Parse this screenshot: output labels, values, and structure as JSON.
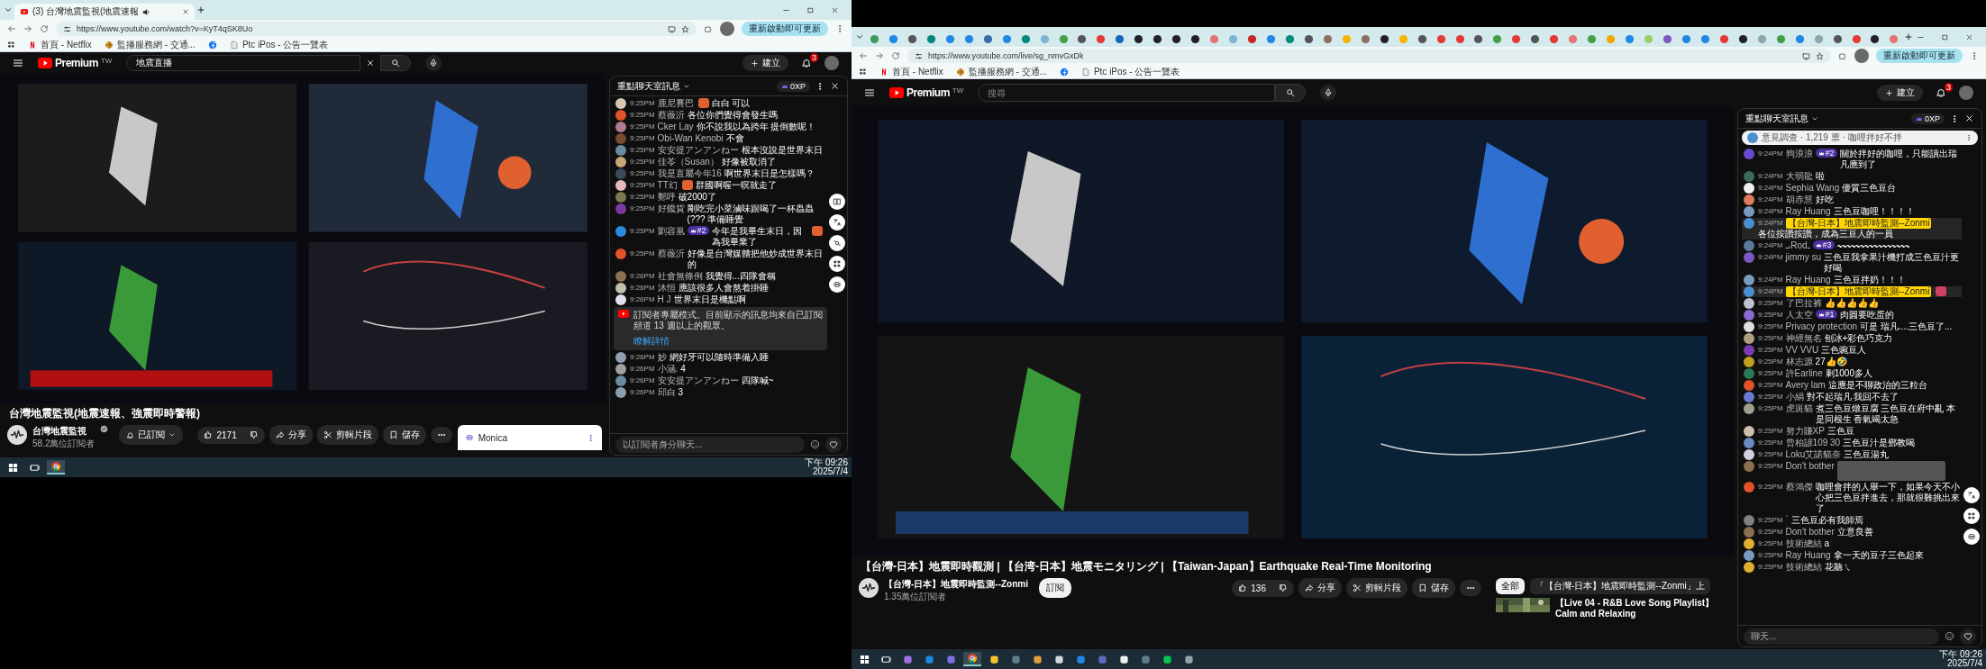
{
  "windows": [
    {
      "tabs": [
        {
          "title": "(3) 台灣地震監視(地震速報",
          "selected": true,
          "audio": true,
          "color": "#e02020"
        }
      ],
      "address": {
        "url": "https://www.youtube.com/watch?v=KyT4qSK8Uo"
      },
      "update_button": "重新啟動即可更新",
      "bookmarks": [
        {
          "label": "首頁 - Netflix",
          "kind": "netflix"
        },
        {
          "label": "監播服務網 - 交通...",
          "kind": "globe"
        },
        {
          "kind": "facebook"
        },
        {
          "label": "Ptc iPos - 公告一覽表",
          "kind": "doc"
        }
      ],
      "youtube": {
        "logo": "Premium",
        "logo_sup": "TW",
        "search": {
          "value": "地震直播"
        },
        "create": "建立",
        "notifications": "3"
      },
      "video": {
        "kind": "picture"
      },
      "title": "台灣地震監視(地震速報、強震即時警報)",
      "channel": {
        "name": "台灣地震監視",
        "subscribers": "58.2萬位訂閱者",
        "verified": true,
        "subscribe": {
          "label": "已訂閱",
          "subscribed": true
        }
      },
      "actions": {
        "likes": "2171",
        "share": "分享",
        "clip": "剪輯片段",
        "save": "儲存"
      },
      "monica": {
        "title": "Monica"
      },
      "chat": {
        "title": "重點聊天室訊息",
        "xp": "0XP",
        "input_placeholder": "以訂閱者身分聊天...",
        "side_tools": [
          {
            "kind": "book"
          },
          {
            "kind": "translate"
          },
          {
            "kind": "target"
          },
          {
            "kind": "grid"
          },
          {
            "kind": "robot"
          }
        ],
        "messages": [
          {
            "time": "9:25PM",
            "author": "鹿尼賽巴",
            "text": "白白 可以",
            "sticker_before": true,
            "color": "#d8c8b0"
          },
          {
            "time": "9:25PM",
            "author": "蔡薇沂",
            "text": "各位你們覺得會發生嗎",
            "color": "#e0522a"
          },
          {
            "time": "9:25PM",
            "author": "Cker Lay",
            "text": "你不說我以為跨年 提倒數呢！",
            "color": "#b07a90"
          },
          {
            "time": "9:25PM",
            "author": "Obi-Wan Kenobi",
            "text": "不會",
            "color": "#7a4a30"
          },
          {
            "time": "9:25PM",
            "author": "安安提アンアンねー",
            "text": "根本沒說是世界末日",
            "color": "#6a8aa0"
          },
          {
            "time": "9:25PM",
            "author": "佳苓（Susan）",
            "text": "好像被取消了",
            "color": "#c8a878"
          },
          {
            "time": "9:25PM",
            "author": "我是直屬今年16",
            "text": "啊世界末日是怎樣嗎？",
            "color": "#3a4a5a"
          },
          {
            "time": "9:25PM",
            "author": "TT幻",
            "text": "群國啊喔一暝就走了",
            "sticker_before": true,
            "color": "#e8b8c0"
          },
          {
            "time": "9:25PM",
            "author": "鄭呼",
            "text": "破2000了",
            "color": "#7a7a50"
          },
          {
            "time": "9:25PM",
            "author": "好饞貨",
            "text": "剛吃完小菜滷味跟喝了一杯蟲蟲(??? 準備睡覺",
            "color": "#7a3aa0"
          },
          {
            "time": "9:25PM",
            "author": "劉容凰",
            "badge": "#2",
            "text": "今年是我畢生末日，因為我畢業了",
            "sticker_after": true,
            "color": "#2a8ae0"
          },
          {
            "time": "9:25PM",
            "author": "蔡薇沂",
            "text": "好像是台灣媒體把他炒成世界末日的",
            "color": "#e0522a"
          },
          {
            "time": "9:26PM",
            "author": "社會無條例",
            "text": "我覺得...四隊會稱",
            "color": "#8a7050"
          },
          {
            "time": "9:26PM",
            "author": "沐恒",
            "text": "應該很多人會熬着掛睡",
            "color": "#c0c0b0"
          },
          {
            "time": "9:26PM",
            "author": "H J",
            "text": "世界末日是機點啊",
            "color": "#e0e0f0"
          },
          {
            "kind": "notice",
            "text": "訂閱者專屬模式。目前顯示的訊息均來自已訂閱頻道 13 週以上的觀眾。",
            "link": "瞭解詳情"
          },
          {
            "time": "9:26PM",
            "author": "妙",
            "text": "網好牙可以隨時準備入睡",
            "color": "#90a0b0"
          },
          {
            "time": "9:26PM",
            "author": "小涵.",
            "text": "4",
            "color": "#a0a0a0"
          },
          {
            "time": "9:26PM",
            "author": "安安提アンアンねー",
            "text": "四隊喊~",
            "color": "#6a8aa0"
          },
          {
            "time": "9:26PM",
            "author": "邱白",
            "text": "3",
            "color": "#8aa0b0"
          }
        ]
      },
      "taskbar": {
        "time": "下午 09:26",
        "date": "2025/7/4",
        "apps": [
          {
            "kind": "start",
            "selected": false
          },
          {
            "kind": "taskview",
            "selected": false
          },
          {
            "kind": "chrome",
            "selected": true
          }
        ]
      }
    },
    {
      "tabs": [
        {
          "color": "#3c9a5f"
        },
        {
          "color": "#1e88e5"
        },
        {
          "color": "#555555"
        },
        {
          "color": "#00897b"
        },
        {
          "color": "#1e88e5"
        },
        {
          "color": "#1e88e5"
        },
        {
          "color": "#3a6ea8"
        },
        {
          "color": "#1e88e5"
        },
        {
          "color": "#00897b"
        },
        {
          "color": "#7fb3d5"
        },
        {
          "color": "#43a047"
        },
        {
          "color": "#555555"
        },
        {
          "color": "#e53935"
        },
        {
          "color": "#1565c0"
        },
        {
          "color": "#212121"
        },
        {
          "color": "#212121"
        },
        {
          "color": "#212121"
        },
        {
          "color": "#212121"
        },
        {
          "color": "#e57373"
        },
        {
          "color": "#7fb3d5"
        },
        {
          "color": "#c62828"
        },
        {
          "color": "#1e88e5"
        },
        {
          "color": "#00897b"
        },
        {
          "color": "#555555"
        },
        {
          "color": "#8d6e63"
        },
        {
          "color": "#f4b400"
        },
        {
          "color": "#8d6e63"
        },
        {
          "color": "#212121"
        },
        {
          "color": "#f4b400"
        },
        {
          "color": "#555555"
        },
        {
          "color": "#e53935"
        },
        {
          "color": "#e53935"
        },
        {
          "color": "#555555"
        },
        {
          "color": "#43a047"
        },
        {
          "color": "#e53935"
        },
        {
          "color": "#555555"
        },
        {
          "color": "#e53935"
        },
        {
          "color": "#e57373"
        },
        {
          "color": "#43a047"
        },
        {
          "color": "#f4a400"
        },
        {
          "color": "#1e88e5"
        },
        {
          "color": "#9ccc65"
        },
        {
          "color": "#7e57c2"
        },
        {
          "color": "#1e88e5"
        },
        {
          "color": "#1e88e5"
        },
        {
          "color": "#e53935"
        },
        {
          "color": "#212121"
        },
        {
          "color": "#90a4ae"
        },
        {
          "color": "#43a047"
        },
        {
          "color": "#1e88e5"
        },
        {
          "color": "#90a4ae"
        },
        {
          "color": "#555555"
        },
        {
          "color": "#e53935"
        },
        {
          "color": "#212121"
        },
        {
          "color": "#e57373"
        }
      ],
      "address": {
        "url": "https://www.youtube.com/live/sg_nmvGxDk"
      },
      "update_button": "重新啟動即可更新",
      "bookmarks": [
        {
          "label": "首頁 - Netflix",
          "kind": "netflix"
        },
        {
          "label": "監播服務網 - 交通...",
          "kind": "globe"
        },
        {
          "kind": "facebook"
        },
        {
          "label": "Ptc iPos - 公告一覽表",
          "kind": "doc"
        }
      ],
      "youtube": {
        "logo": "Premium",
        "logo_sup": "TW",
        "search": {
          "placeholder": "搜尋"
        },
        "create": "建立",
        "notifications": "3"
      },
      "video": {
        "kind": "picture"
      },
      "title": "【台灣-日本】地震即時觀測 | 【台湾-日本】地震モニタリング | 【Taiwan-Japan】Earthquake Real-Time Monitoring",
      "channel": {
        "name": "【台灣-日本】地震即時監測--Zonmi",
        "subscribers": "1.35萬位訂閱者",
        "verified": false,
        "subscribe": {
          "label": "訂閱",
          "subscribed": false
        }
      },
      "actions": {
        "likes": "136",
        "share": "分享",
        "clip": "剪輯片段",
        "save": "儲存"
      },
      "chips": [
        {
          "label": "全部",
          "selected": true
        },
        {
          "label": "「【台灣-日本】地震即時監測--Zonmi」上",
          "selected": false
        }
      ],
      "recommendation": {
        "title": "【Live 04 - R&B Love Song Playlist】Calm and Relaxing"
      },
      "chat": {
        "title": "重點聊天室訊息",
        "xp": "0XP",
        "input_placeholder": "聊天...",
        "side_tools": [
          {
            "kind": "translate"
          },
          {
            "kind": "grid"
          },
          {
            "kind": "robot"
          }
        ],
        "pinned": {
          "text": "意見調查 · 1,219 票 · 咖哩拌好不拌"
        },
        "messages": [
          {
            "time": "9:24PM",
            "author": "狗浪浪",
            "badge": "#2",
            "text": "關於拌好的咖哩，只能讀出瑞凡應到了",
            "color": "#6a4ad0"
          },
          {
            "time": "9:24PM",
            "author": "大弱龍",
            "text": "啦",
            "color": "#3a6a5a"
          },
          {
            "time": "9:24PM",
            "author": "Sephia Wang",
            "text": "優質三色豆台",
            "color": "#f0f0f0"
          },
          {
            "time": "9:24PM",
            "author": "胡赤慧",
            "text": "好吃",
            "color": "#e07a5a"
          },
          {
            "time": "9:24PM",
            "author": "Ray Huang",
            "text": "三色豆咖哩！！！！",
            "color": "#7a9ac0"
          },
          {
            "time": "9:24PM",
            "author": "【台灣-日本】地震即時監測--Zonmi",
            "owner": true,
            "text": "各位按讚按讚，成為三豆人的一員",
            "color": "#4a90d0"
          },
          {
            "time": "9:24PM",
            "author": "ىـRodـ",
            "badge": "#3",
            "text": "〰〰〰〰〰〰〰〰",
            "color": "#5a7a9a"
          },
          {
            "time": "9:24PM",
            "author": "jimmy su",
            "text": "三色豆我拿果汁機打成三色豆汁更好喝",
            "color": "#7a5ac0"
          },
          {
            "time": "9:24PM",
            "author": "Ray Huang",
            "text": "三色豆拌奶！！！",
            "color": "#7a9ac0"
          },
          {
            "time": "9:24PM",
            "author": "【台灣-日本】地震即時監測--Zonmi",
            "owner": true,
            "sticker_after": true,
            "color": "#4a90d0"
          },
          {
            "time": "9:25PM",
            "author": "了巴拉裤",
            "text": "👍👍👍👍👍",
            "color": "#c0c0d0"
          },
          {
            "time": "9:25PM",
            "author": "人太空",
            "badge": "#1",
            "text": "肉圓要吃蛋的",
            "color": "#8a6ad0"
          },
          {
            "time": "9:25PM",
            "author": "Privacy protection",
            "text": "可是 瑞凡....三色豆了...",
            "color": "#e0e0e0"
          },
          {
            "time": "9:25PM",
            "author": "神經無名",
            "text": "刨冰+彩色巧克力",
            "color": "#b0a080"
          },
          {
            "time": "9:25PM",
            "author": "VV VVU",
            "text": "三色豌豆人",
            "color": "#7a3ab0"
          },
          {
            "time": "9:25PM",
            "author": "林志源",
            "text": "27👍🤣",
            "color": "#c0a020"
          },
          {
            "time": "9:25PM",
            "author": "許Earline",
            "text": "剩1000多人",
            "color": "#2a7a5a"
          },
          {
            "time": "9:25PM",
            "author": "Avery lam",
            "text": "這應是不聊政治的三粒台",
            "color": "#e0522a"
          },
          {
            "time": "9:25PM",
            "author": "小絹",
            "text": "對不起瑞凡 我回不去了",
            "color": "#6a7ad0"
          },
          {
            "time": "9:25PM",
            "author": "虎斑貓",
            "text": "煮三色豆燉豆腐 三色豆在府中亂 本是同根生 香氣竭太急",
            "color": "#a0a090"
          },
          {
            "time": "9:25PM",
            "author": "努力賺XP",
            "text": "三色豆",
            "color": "#d0c0b0"
          },
          {
            "time": "9:25PM",
            "author": "曾柏諺109 30",
            "text": "三色豆汁是鄧教喝",
            "color": "#6a8ac0"
          },
          {
            "time": "9:25PM",
            "author": "Loku艾諾貓奈",
            "text": "三色豆湯丸",
            "color": "#d0d0e0"
          },
          {
            "time": "9:25PM",
            "author": "Don't bother",
            "hidden": true,
            "color": "#8a7050"
          },
          {
            "time": "9:25PM",
            "author": "蔡鴻傑",
            "text": "咖哩會拌的人舉一下，如果今天不小心把三色豆拌進去，那就很難挑出來了",
            "color": "#e0522a"
          },
          {
            "time": "9:25PM",
            "author": "`",
            "text": "三色豆必有我師焉",
            "color": "#808080"
          },
          {
            "time": "9:25PM",
            "author": "Don't bother",
            "text": "立意良善",
            "color": "#8a7050"
          },
          {
            "time": "9:25PM",
            "author": "技術總結",
            "text": "a",
            "color": "#e0b030"
          },
          {
            "time": "9:25PM",
            "author": "Ray Huang",
            "text": "拿一天的豆子三色起來",
            "color": "#7a9ac0"
          },
          {
            "time": "9:25PM",
            "author": "技術總結",
            "text": "花聽ㄟ",
            "color": "#e0b030"
          }
        ]
      },
      "taskbar": {
        "time": "下午 09:26",
        "date": "2025/7/4",
        "apps": [
          {
            "kind": "start",
            "selected": false
          },
          {
            "kind": "taskview",
            "selected": false
          },
          {
            "kind": "app",
            "color": "#a070e0",
            "selected": false
          },
          {
            "kind": "app",
            "color": "#1e88e5",
            "selected": false
          },
          {
            "kind": "app",
            "color": "#7a70e0",
            "selected": false
          },
          {
            "kind": "chrome",
            "selected": true
          },
          {
            "kind": "app",
            "color": "#f4c430",
            "selected": false
          },
          {
            "kind": "app",
            "color": "#607d8b",
            "selected": false
          },
          {
            "kind": "app",
            "color": "#e0a040",
            "selected": false
          },
          {
            "kind": "app",
            "color": "#cfd8dc",
            "selected": false
          },
          {
            "kind": "app",
            "color": "#1e88e5",
            "selected": false
          },
          {
            "kind": "app",
            "color": "#5c6bc0",
            "selected": false
          },
          {
            "kind": "app",
            "color": "#eceff1",
            "selected": false
          },
          {
            "kind": "app",
            "color": "#607d8b",
            "selected": false
          },
          {
            "kind": "app",
            "color": "#06c755",
            "selected": false
          },
          {
            "kind": "app",
            "color": "#90a4ae",
            "selected": false
          }
        ]
      }
    }
  ]
}
